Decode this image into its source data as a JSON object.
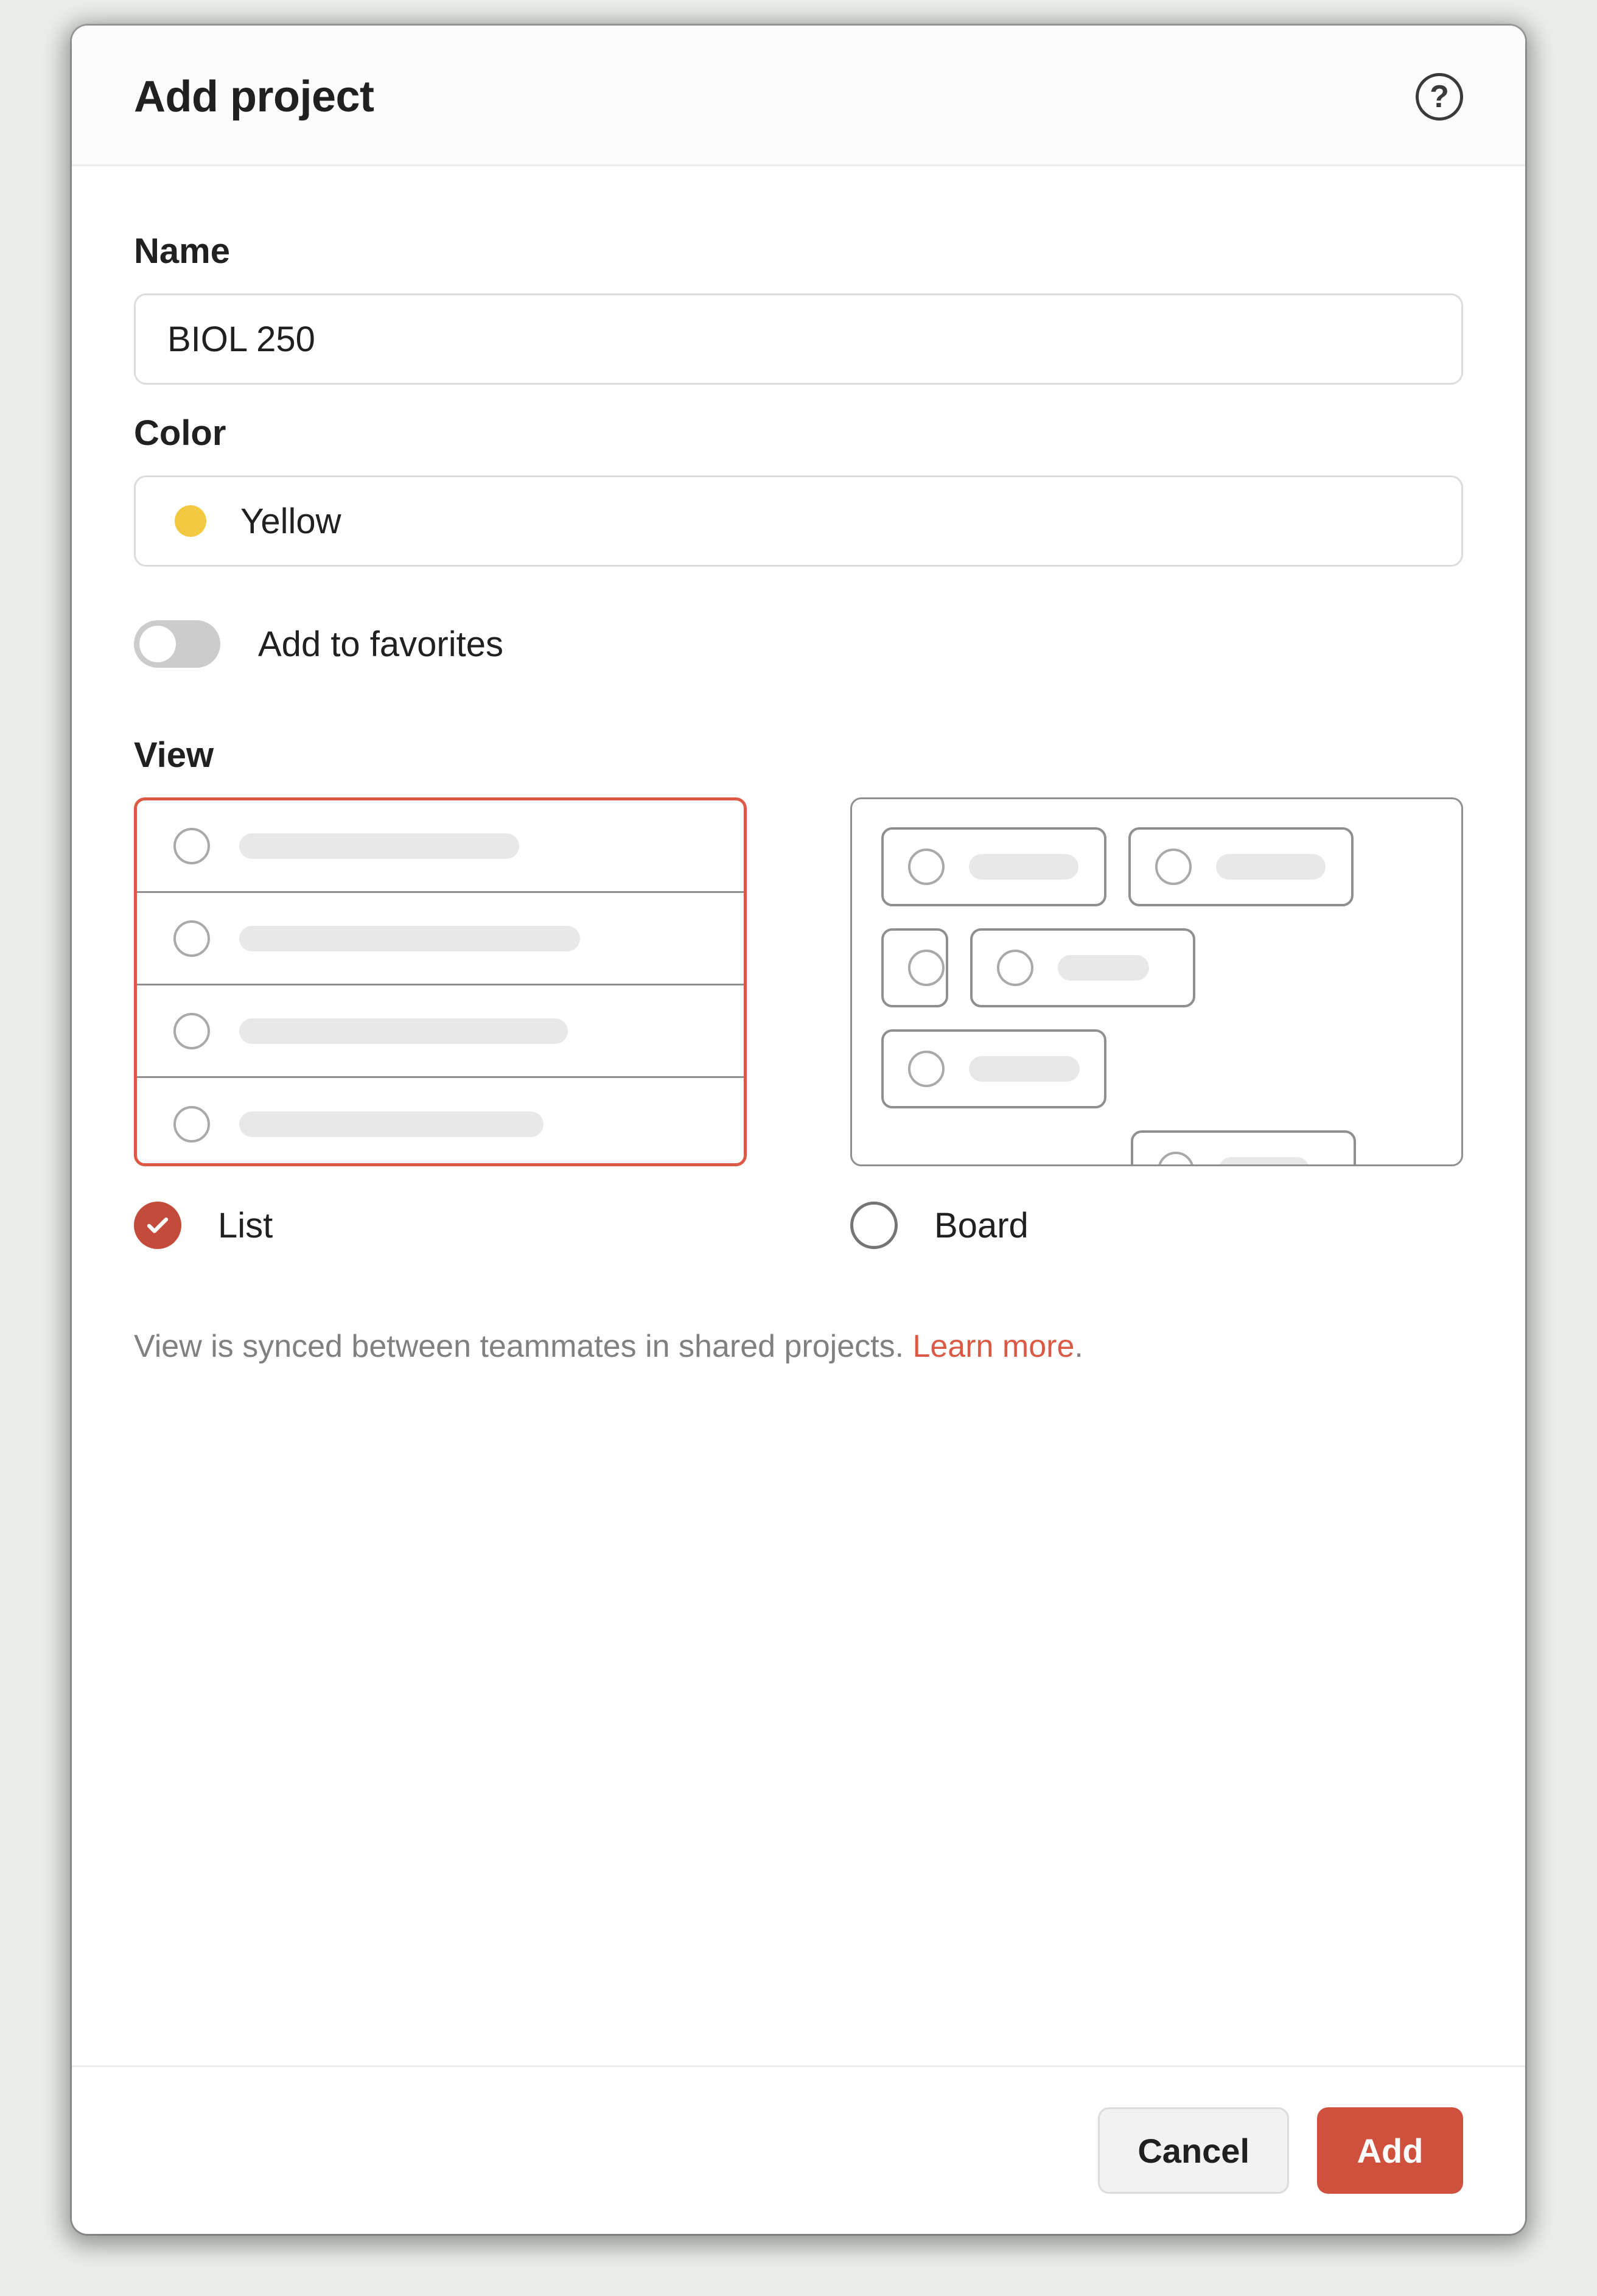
{
  "dialog": {
    "title": "Add project"
  },
  "fields": {
    "name": {
      "label": "Name",
      "value": "BIOL 250"
    },
    "color": {
      "label": "Color",
      "selected_name": "Yellow",
      "swatch_hex": "#f2c93f"
    },
    "favorites": {
      "label": "Add to favorites",
      "enabled": false
    },
    "view": {
      "label": "View",
      "options": {
        "list": {
          "label": "List",
          "selected": true
        },
        "board": {
          "label": "Board",
          "selected": false
        }
      },
      "hint_text": "View is synced between teammates in shared projects. ",
      "hint_link": "Learn more"
    }
  },
  "footer": {
    "cancel": "Cancel",
    "add": "Add"
  },
  "accent_color": "#cf513d"
}
